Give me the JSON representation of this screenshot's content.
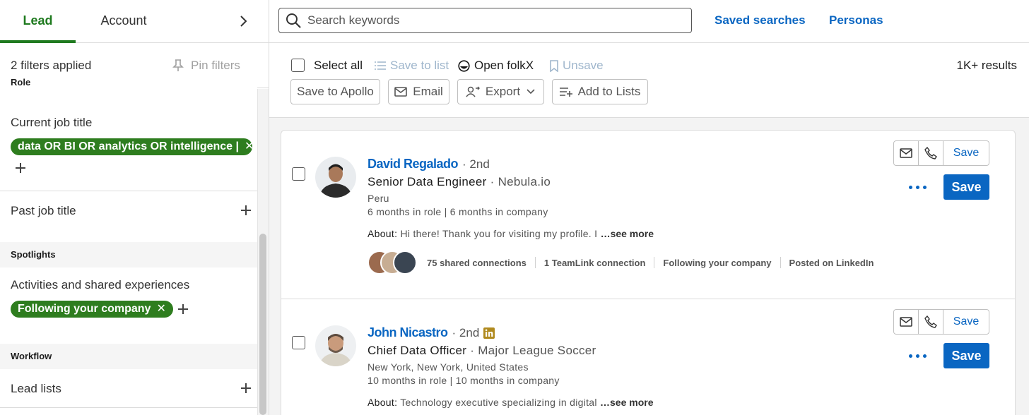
{
  "tabs": {
    "lead": "Lead",
    "account": "Account"
  },
  "filters": {
    "count_label": "2 filters applied",
    "pin_label": "Pin filters"
  },
  "sections": {
    "role": "Role",
    "spotlights": "Spotlights",
    "workflow": "Workflow"
  },
  "role": {
    "current_job_title": "Current job title",
    "chip": "data OR BI OR analytics OR intelligence |",
    "past_job_title": "Past job title"
  },
  "spotlights": {
    "activities": "Activities and shared experiences",
    "chip": "Following your company"
  },
  "workflow": {
    "lead_lists": "Lead lists"
  },
  "search": {
    "placeholder": "Search keywords",
    "value": ""
  },
  "toplinks": {
    "saved_searches": "Saved searches",
    "personas": "Personas"
  },
  "actions": {
    "select_all": "Select all",
    "save_to_list": "Save to list",
    "open_folkx": "Open folkX",
    "unsave": "Unsave",
    "results": "1K+ results",
    "save_to_apollo": "Save to Apollo",
    "email": "Email",
    "export": "Export",
    "add_to_lists": "Add to Lists"
  },
  "leads": [
    {
      "name": "David Regalado",
      "degree": "· 2nd",
      "title": "Senior Data Engineer",
      "company": "Nebula.io",
      "location": "Peru",
      "tenure": "6 months in role | 6 months in company",
      "about_label": "About:",
      "about": "Hi there! Thank you for visiting my profile. I",
      "see_more": "…see more",
      "insights": {
        "shared": "75 shared connections",
        "teamlink": "1 TeamLink connection",
        "following": "Following your company",
        "posted": "Posted on LinkedIn"
      },
      "save_label": "Save",
      "save_button": "Save"
    },
    {
      "name": "John Nicastro",
      "degree": "· 2nd",
      "title": "Chief Data Officer",
      "company": "Major League Soccer",
      "location": "New York, New York, United States",
      "tenure": "10 months in role | 10 months in company",
      "about_label": "About:",
      "about": "Technology executive specializing in digital",
      "see_more": "…see more",
      "save_label": "Save",
      "save_button": "Save"
    }
  ],
  "colors": {
    "accent": "#0a66c2",
    "green": "#2e7d1f",
    "tab_green": "#1f7a1f"
  }
}
